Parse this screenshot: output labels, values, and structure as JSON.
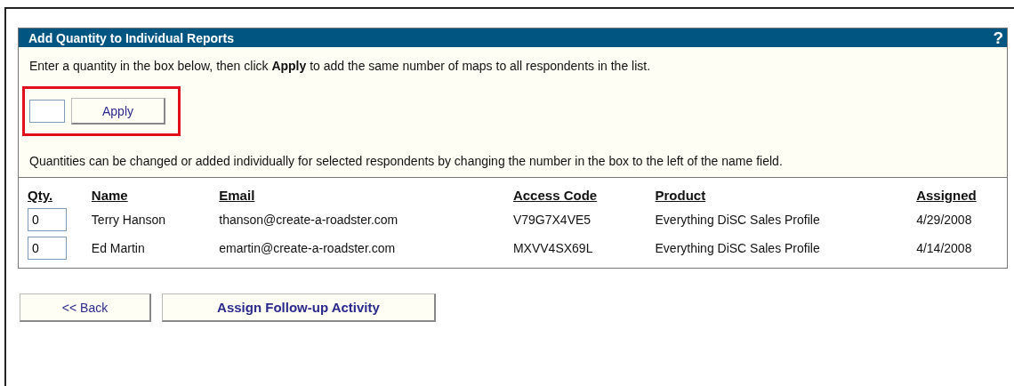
{
  "panel": {
    "title": "Add Quantity to Individual Reports",
    "help": "?",
    "intro": "Enter a quantity in the box below, then click **Apply** to add the same number of maps to all respondents in the list.",
    "apply_button": "Apply",
    "note": "Quantities can be changed or added individually for selected respondents by changing the number in the box to the left of the name field."
  },
  "table": {
    "columns": [
      "Qty.",
      "Name",
      "Email",
      "Access Code",
      "Product",
      "Assigned"
    ],
    "rows": [
      {
        "qty": "0",
        "name": "Terry Hanson",
        "email": "thanson@create-a-roadster.com",
        "access_code": "V79G7X4VE5",
        "product": "Everything DiSC Sales Profile",
        "assigned": "4/29/2008"
      },
      {
        "qty": "0",
        "name": "Ed Martin",
        "email": "emartin@create-a-roadster.com",
        "access_code": "MXVV4SX69L",
        "product": "Everything DiSC Sales Profile",
        "assigned": "4/14/2008"
      }
    ]
  },
  "buttons": [
    {
      "label": "<< Back",
      "kind": "plain"
    },
    {
      "label": "Assign Follow-up Activity",
      "kind": "bold"
    }
  ]
}
